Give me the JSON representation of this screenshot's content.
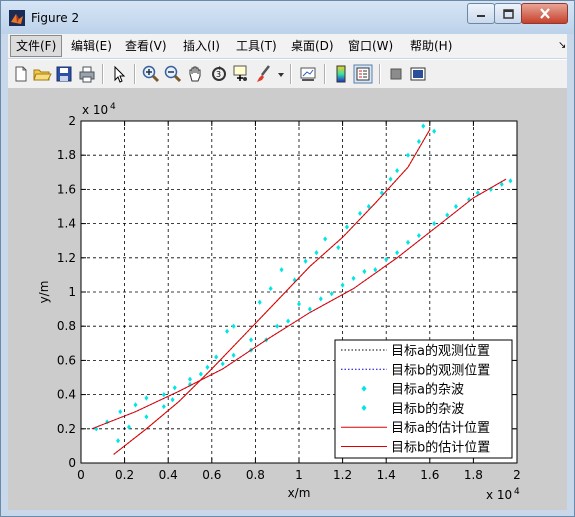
{
  "window": {
    "title": "Figure 2"
  },
  "menu": [
    {
      "label": "文件(F)",
      "active": true
    },
    {
      "label": "编辑(E)"
    },
    {
      "label": "查看(V)"
    },
    {
      "label": "插入(I)"
    },
    {
      "label": "工具(T)"
    },
    {
      "label": "桌面(D)"
    },
    {
      "label": "窗口(W)"
    },
    {
      "label": "帮助(H)"
    }
  ],
  "toolbar_icons": [
    "new-figure-icon",
    "open-file-icon",
    "save-icon",
    "print-icon",
    "pointer-icon",
    "zoom-in-icon",
    "zoom-out-icon",
    "pan-icon",
    "rotate-3d-icon",
    "data-cursor-icon",
    "brush-icon",
    "dropdown-arrow-icon",
    "link-plot-icon",
    "colorbar-icon",
    "legend-icon",
    "hide-plot-tools-icon",
    "show-plot-tools-icon"
  ],
  "chart_data": {
    "type": "line",
    "xlabel": "x/m",
    "ylabel": "y/m",
    "x_multiplier": "x 10",
    "x_multiplier_exp": "4",
    "y_multiplier": "x 10",
    "y_multiplier_exp": "4",
    "xlim": [
      0,
      2
    ],
    "ylim": [
      0,
      2
    ],
    "xticks": [
      "0",
      "0.2",
      "0.4",
      "0.6",
      "0.8",
      "1",
      "1.2",
      "1.4",
      "1.6",
      "1.8",
      "2"
    ],
    "yticks": [
      "0",
      "0.2",
      "0.4",
      "0.6",
      "0.8",
      "1",
      "1.2",
      "1.4",
      "1.6",
      "1.8",
      "2"
    ],
    "grid": true,
    "legend_position": "bottom-right",
    "colors": {
      "observed_a": "#000000",
      "observed_b": "#0000cc",
      "clutter": "#00e5e5",
      "estimate": "#e00000"
    },
    "series": [
      {
        "name": "目标a的观测位置",
        "style": "dotted-black",
        "points": [
          [
            0.15,
            0.05
          ],
          [
            0.3,
            0.2
          ],
          [
            0.45,
            0.36
          ],
          [
            0.6,
            0.55
          ],
          [
            0.75,
            0.75
          ],
          [
            0.9,
            0.95
          ],
          [
            1.05,
            1.15
          ],
          [
            1.2,
            1.32
          ],
          [
            1.35,
            1.52
          ],
          [
            1.5,
            1.73
          ],
          [
            1.6,
            1.95
          ]
        ]
      },
      {
        "name": "目标b的观测位置",
        "style": "dotted-blue",
        "points": [
          [
            0.05,
            0.2
          ],
          [
            0.25,
            0.3
          ],
          [
            0.45,
            0.42
          ],
          [
            0.65,
            0.55
          ],
          [
            0.85,
            0.72
          ],
          [
            1.05,
            0.88
          ],
          [
            1.25,
            1.02
          ],
          [
            1.45,
            1.2
          ],
          [
            1.65,
            1.4
          ],
          [
            1.8,
            1.55
          ],
          [
            1.95,
            1.66
          ]
        ]
      },
      {
        "name": "目标a的杂波",
        "style": "cyan-dots",
        "points": [
          [
            0.17,
            0.13
          ],
          [
            0.22,
            0.21
          ],
          [
            0.3,
            0.27
          ],
          [
            0.38,
            0.33
          ],
          [
            0.42,
            0.37
          ],
          [
            0.5,
            0.46
          ],
          [
            0.55,
            0.52
          ],
          [
            0.62,
            0.62
          ],
          [
            0.67,
            0.77
          ],
          [
            0.7,
            0.8
          ],
          [
            0.78,
            0.72
          ],
          [
            0.82,
            0.94
          ],
          [
            0.87,
            1.02
          ],
          [
            0.92,
            1.13
          ],
          [
            0.98,
            1.07
          ],
          [
            1.03,
            1.18
          ],
          [
            1.08,
            1.23
          ],
          [
            1.12,
            1.31
          ],
          [
            1.18,
            1.26
          ],
          [
            1.22,
            1.38
          ],
          [
            1.28,
            1.46
          ],
          [
            1.32,
            1.5
          ],
          [
            1.38,
            1.58
          ],
          [
            1.42,
            1.66
          ],
          [
            1.45,
            1.71
          ],
          [
            1.5,
            1.8
          ],
          [
            1.55,
            1.88
          ],
          [
            1.57,
            1.97
          ],
          [
            1.62,
            1.94
          ]
        ]
      },
      {
        "name": "目标b的杂波",
        "style": "cyan-dots",
        "points": [
          [
            0.07,
            0.2
          ],
          [
            0.12,
            0.24
          ],
          [
            0.18,
            0.3
          ],
          [
            0.25,
            0.34
          ],
          [
            0.3,
            0.38
          ],
          [
            0.38,
            0.4
          ],
          [
            0.43,
            0.44
          ],
          [
            0.5,
            0.49
          ],
          [
            0.58,
            0.56
          ],
          [
            0.65,
            0.58
          ],
          [
            0.7,
            0.63
          ],
          [
            0.78,
            0.66
          ],
          [
            0.85,
            0.72
          ],
          [
            0.9,
            0.8
          ],
          [
            0.95,
            0.83
          ],
          [
            1.0,
            0.93
          ],
          [
            1.05,
            0.9
          ],
          [
            1.1,
            0.96
          ],
          [
            1.15,
            0.99
          ],
          [
            1.2,
            1.04
          ],
          [
            1.25,
            1.08
          ],
          [
            1.3,
            1.12
          ],
          [
            1.35,
            1.13
          ],
          [
            1.4,
            1.19
          ],
          [
            1.45,
            1.23
          ],
          [
            1.5,
            1.29
          ],
          [
            1.55,
            1.33
          ],
          [
            1.62,
            1.4
          ],
          [
            1.68,
            1.45
          ],
          [
            1.72,
            1.5
          ],
          [
            1.78,
            1.54
          ],
          [
            1.82,
            1.58
          ],
          [
            1.88,
            1.6
          ],
          [
            1.93,
            1.63
          ],
          [
            1.97,
            1.65
          ]
        ]
      },
      {
        "name": "目标a的估计位置",
        "style": "solid-red",
        "points": [
          [
            0.15,
            0.05
          ],
          [
            0.3,
            0.2
          ],
          [
            0.45,
            0.36
          ],
          [
            0.6,
            0.55
          ],
          [
            0.75,
            0.75
          ],
          [
            0.9,
            0.95
          ],
          [
            1.05,
            1.15
          ],
          [
            1.2,
            1.32
          ],
          [
            1.35,
            1.52
          ],
          [
            1.5,
            1.73
          ],
          [
            1.6,
            1.95
          ]
        ]
      },
      {
        "name": "目标b的估计位置",
        "style": "solid-red",
        "points": [
          [
            0.05,
            0.2
          ],
          [
            0.25,
            0.3
          ],
          [
            0.45,
            0.42
          ],
          [
            0.65,
            0.55
          ],
          [
            0.85,
            0.72
          ],
          [
            1.05,
            0.88
          ],
          [
            1.25,
            1.02
          ],
          [
            1.45,
            1.2
          ],
          [
            1.65,
            1.4
          ],
          [
            1.8,
            1.55
          ],
          [
            1.95,
            1.66
          ]
        ]
      }
    ]
  }
}
